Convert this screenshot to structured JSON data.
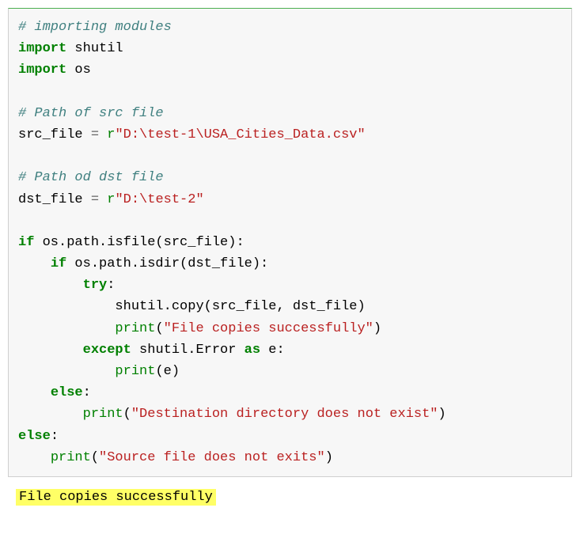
{
  "code": {
    "c1": "# importing modules",
    "kw_import1": "import",
    "mod_shutil": " shutil",
    "kw_import2": "import",
    "mod_os": " os",
    "c2": "# Path of src file",
    "var_src": "src_file ",
    "op_eq1": "=",
    "pfx_r1": " r",
    "str_src": "\"D:\\test-1\\USA_Cities_Data.csv\"",
    "c3": "# Path od dst file",
    "var_dst": "dst_file ",
    "op_eq2": "=",
    "pfx_r2": " r",
    "str_dst": "\"D:\\test-2\"",
    "kw_if1": "if",
    "call_isfile": " os.path.isfile(src_file):",
    "kw_if2": "if",
    "call_isdir": " os.path.isdir(dst_file):",
    "kw_try": "try",
    "colon1": ":",
    "call_copy": "shutil.copy(src_file, dst_file)",
    "fn_print1": "print",
    "paren_o1": "(",
    "str_succ": "\"File copies successfully\"",
    "paren_c1": ")",
    "kw_except": "except",
    "exc_err": " shutil.Error ",
    "kw_as": "as",
    "var_e": " e:",
    "fn_print2": "print",
    "args_e": "(e)",
    "kw_else1": "else",
    "colon2": ":",
    "fn_print3": "print",
    "paren_o3": "(",
    "str_dstne": "\"Destination directory does not exist\"",
    "paren_c3": ")",
    "kw_else2": "else",
    "colon3": ":",
    "fn_print4": "print",
    "paren_o4": "(",
    "str_srcne": "\"Source file does not exits\"",
    "paren_c4": ")"
  },
  "output": {
    "line1": "File copies successfully"
  }
}
